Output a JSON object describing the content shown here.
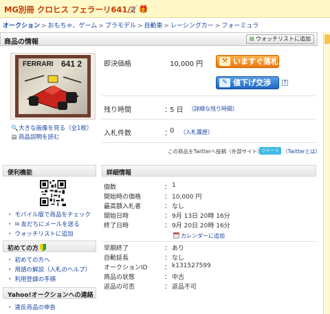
{
  "header": {
    "title": "MG別冊 クロヒス フェラーリ641/2",
    "icons": [
      "cart-icon",
      "gift-icon"
    ]
  },
  "breadcrumb": [
    "オークション",
    "おもちゃ、ゲーム",
    "プラモデル",
    "自動車",
    "レーシングカー",
    "フォーミュラ"
  ],
  "product_bar": {
    "title": "商品の情報",
    "watch_button": "ウォッチリストに追加"
  },
  "image": {
    "cover_title": "FERRARI",
    "cover_number": "641 2",
    "enlarge_link": "大きな画像を見る（全1枚）",
    "description_link": "商品説明を読む"
  },
  "price": {
    "label": "即決価格",
    "value": "10,000 円",
    "buy_button": "いますぐ落札",
    "negotiate_button": "値下げ交渉",
    "help": "?"
  },
  "time_left": {
    "label": "残り時間",
    "colon": "：",
    "value": "5 日",
    "detail_link": "（詳細な残り時間）"
  },
  "bids": {
    "label": "入札件数",
    "colon": "：",
    "value": "0",
    "history_link": "（入札履歴）"
  },
  "twitter": {
    "text": "この商品をTwitterへ投稿（外部サイト）",
    "button": "ツイート",
    "about": "（Twitterとは）"
  },
  "sidebar": {
    "benri_title": "便利機能",
    "benri_links": [
      "モバイル版で商品をチェック",
      "友だちにメールを送る",
      "ウォッチリストに追加"
    ],
    "first_title": "初めての方",
    "first_links": [
      "初めての方へ",
      "用語の解説（入札のヘルプ）",
      "利用登録の手順"
    ],
    "contact_title": "Yahoo!オークションへの連絡",
    "report_link": "違反商品の申告"
  },
  "details": {
    "title": "詳細情報",
    "rows_a": [
      {
        "label": "個数",
        "value": "1"
      },
      {
        "label": "開始時の価格",
        "value": "10,000 円"
      },
      {
        "label": "最高額入札者",
        "value": "なし"
      },
      {
        "label": "開始日時",
        "value": "9月 13日 20時 16分"
      },
      {
        "label": "終了日時",
        "value": "9月 20日 20時 16分"
      }
    ],
    "calendar_link": "カレンダーに追加",
    "rows_b": [
      {
        "label": "早期終了",
        "value": "あり"
      },
      {
        "label": "自動延長",
        "value": "なし"
      },
      {
        "label": "オークションID",
        "value": "k131527599"
      },
      {
        "label": "商品の状態",
        "value": "中古"
      },
      {
        "label": "返品の可否",
        "value": "返品不可"
      }
    ],
    "colon": "："
  },
  "colors": {
    "title": "#c43a00",
    "link": "#1a45a0",
    "buy_button": "#ec7a10",
    "negotiate_button": "#1f67c4"
  }
}
